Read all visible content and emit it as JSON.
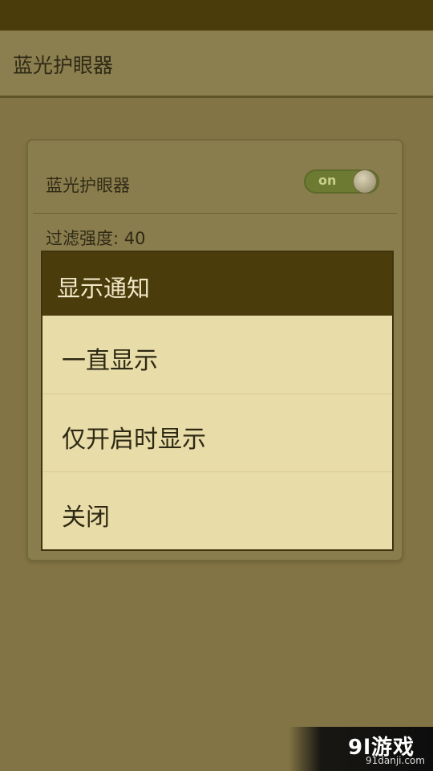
{
  "app_bar": {
    "title": "蓝光护眼器"
  },
  "settings": {
    "toggle_label": "蓝光护眼器",
    "toggle_state": "on",
    "filter_label": "过滤强度: 40"
  },
  "dialog": {
    "title": "显示通知",
    "options": [
      {
        "label": "一直显示"
      },
      {
        "label": "仅开启时显示"
      },
      {
        "label": "关闭"
      }
    ]
  },
  "watermark": {
    "logo": "9l游戏",
    "url": "91danji.com"
  },
  "colors": {
    "status_bar": "#4b3d0b",
    "dialog_header": "#4a3c0b",
    "dialog_body": "#e8dca8",
    "toggle_on": "#6d7a31"
  }
}
